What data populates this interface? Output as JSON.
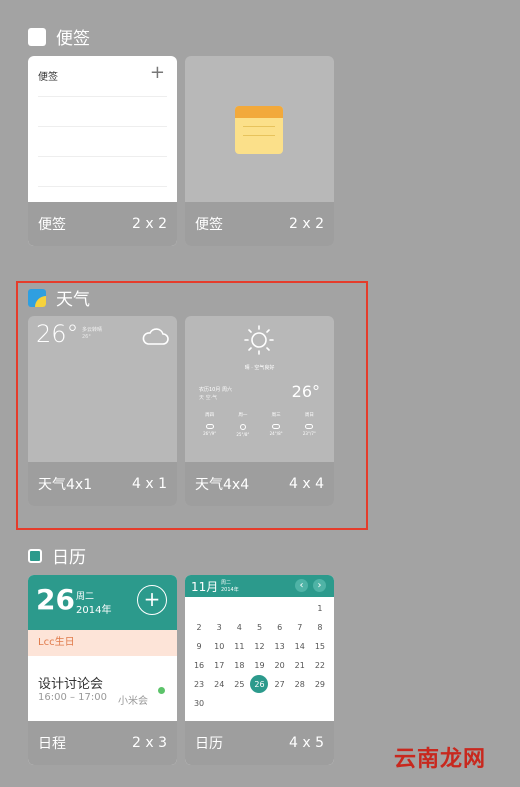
{
  "sections": {
    "notes": {
      "title": "便签"
    },
    "weather": {
      "title": "天气"
    },
    "calendar": {
      "title": "日历"
    }
  },
  "notes_widget_small": {
    "header": "便签",
    "plus": "+",
    "name": "便签",
    "size": "2 x 2"
  },
  "notes_widget_icon": {
    "name": "便签",
    "size": "2 x 2"
  },
  "weather_4x1": {
    "temp": "26°",
    "detail1": "多云转晴",
    "detail2": "26°",
    "name": "天气4x1",
    "size": "4 x 1"
  },
  "weather_4x4": {
    "condition": "晴 · 空气良好",
    "date_line": "农历10月 周六",
    "sub_line": "天 空·气",
    "temp": "26°",
    "forecast": [
      {
        "day": "周四",
        "temp": "26°/9°"
      },
      {
        "day": "周一",
        "temp": "25°/8°"
      },
      {
        "day": "周三",
        "temp": "24°/8°"
      },
      {
        "day": "周日",
        "temp": "23°/7°"
      }
    ],
    "name": "天气4x4",
    "size": "4 x 4"
  },
  "agenda_widget": {
    "day": "26",
    "weekday": "周二",
    "year": "2014年",
    "plus": "+",
    "birthday": "Lcc生日",
    "event_title": "设计讨论会",
    "event_time": "16:00 – 17:00",
    "event_place": "小米会",
    "name": "日程",
    "size": "2 x 3"
  },
  "calendar_widget": {
    "month": "11月",
    "weekday": "周二",
    "year": "2014年",
    "prev": "‹",
    "next": "›",
    "rows": [
      [
        "",
        "",
        "",
        "",
        "",
        "1"
      ],
      [
        "2",
        "3",
        "4",
        "5",
        "6",
        "7",
        "8"
      ],
      [
        "9",
        "10",
        "11",
        "12",
        "13",
        "14",
        "15"
      ],
      [
        "16",
        "17",
        "18",
        "19",
        "20",
        "21",
        "22"
      ],
      [
        "23",
        "24",
        "25",
        "26",
        "27",
        "28",
        "29"
      ],
      [
        "30",
        "",
        "",
        "",
        "",
        "",
        ""
      ]
    ],
    "selected": "26",
    "name": "日历",
    "size": "4 x 5"
  },
  "watermark": "云南龙网",
  "colors": {
    "background": "#a3a3a3",
    "teal": "#2c9a8c",
    "highlight": "#e53c2b",
    "note_yellow": "#f4c064"
  }
}
